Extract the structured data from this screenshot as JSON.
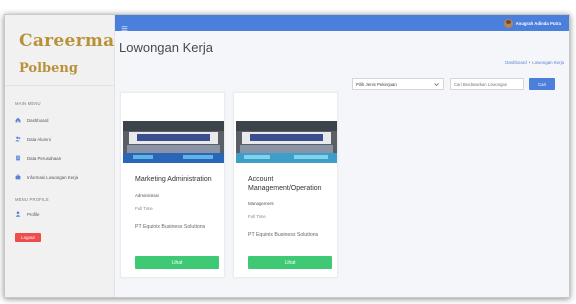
{
  "sidebar": {
    "brand_line1": "Careerma",
    "brand_line2": "Polbeng",
    "main_menu_label": "MAIN MENU",
    "items": [
      {
        "label": "Dashboard",
        "icon": "home-icon"
      },
      {
        "label": "Data Alumni",
        "icon": "users-icon"
      },
      {
        "label": "Data Perusahaan",
        "icon": "building-icon"
      },
      {
        "label": "Informasi Lowongan Kerja",
        "icon": "briefcase-icon"
      }
    ],
    "profile_label": "MENU PROFILE",
    "profile_items": [
      {
        "label": "Profile",
        "icon": "user-icon"
      }
    ],
    "logout_label": "Logout"
  },
  "topbar": {
    "user_name": "Anugrah Adinda Putra"
  },
  "page": {
    "title": "Lowongan Kerja",
    "breadcrumb": [
      "Dashboard",
      "Lowongan Kerja"
    ]
  },
  "filter": {
    "category_value": "Pilih Jenis Pekerjaan",
    "search_placeholder": "Cari Berdasarkan Lowongan",
    "search_button": "Cari"
  },
  "jobs": [
    {
      "title": "Marketing Administration",
      "category": "Administrasi",
      "type": "Full Time",
      "company": "PT Equinix Business Solutions",
      "button": "Lihat"
    },
    {
      "title": "Account Management/Operation",
      "category": "Management",
      "type": "Full Time",
      "company": "PT Equinix Business Solutions",
      "button": "Lihat"
    }
  ],
  "colors": {
    "topbar": "#4a7fdc",
    "brand": "#b9913a",
    "lihat_button": "#3fc974",
    "logout_button": "#ef4d4d"
  }
}
